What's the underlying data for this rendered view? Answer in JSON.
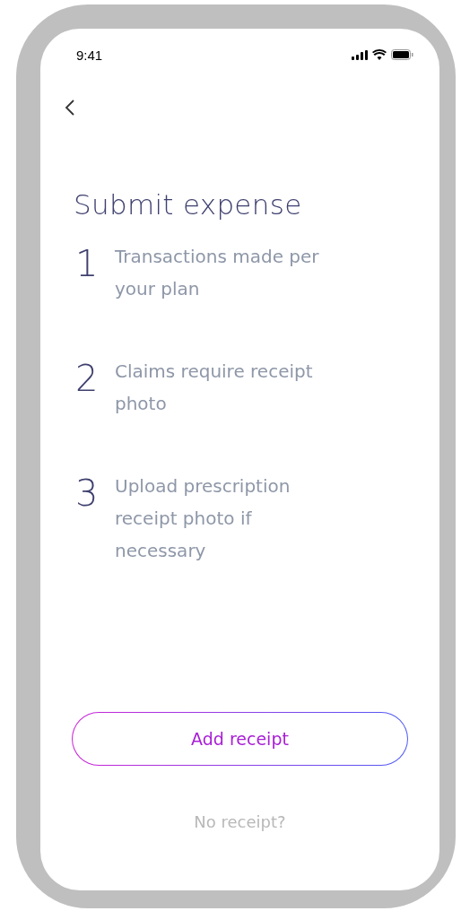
{
  "status_bar": {
    "time": "9:41"
  },
  "title": "Submit expense",
  "steps": [
    {
      "number": "1",
      "text": "Transactions made per your plan"
    },
    {
      "number": "2",
      "text": "Claims require receipt photo"
    },
    {
      "number": "3",
      "text": "Upload prescription receipt photo if necessary"
    }
  ],
  "primary_button": "Add receipt",
  "secondary_link": "No receipt?"
}
